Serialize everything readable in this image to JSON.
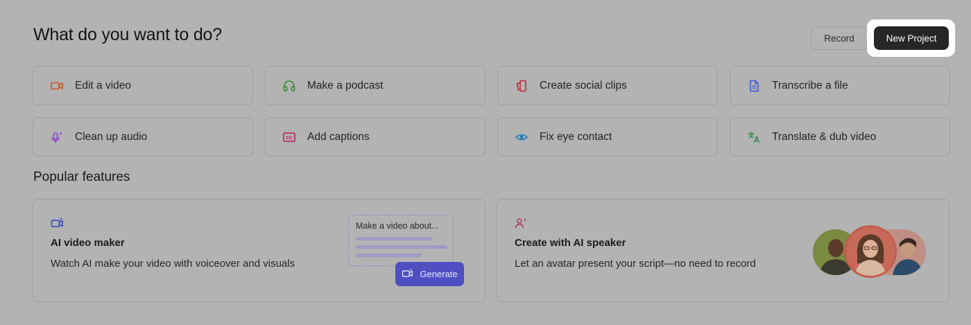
{
  "header": {
    "title": "What do you want to do?",
    "record_label": "Record",
    "new_project_label": "New Project"
  },
  "actions": [
    {
      "label": "Edit a video",
      "icon": "video-camera-icon",
      "color": "#c9521e"
    },
    {
      "label": "Make a podcast",
      "icon": "headphones-icon",
      "color": "#2f8a2f"
    },
    {
      "label": "Create social clips",
      "icon": "social-clips-icon",
      "color": "#c0262f"
    },
    {
      "label": "Transcribe a file",
      "icon": "document-icon",
      "color": "#3b5bd8"
    },
    {
      "label": "Clean up audio",
      "icon": "microphone-sparkle-icon",
      "color": "#8a3fd0"
    },
    {
      "label": "Add captions",
      "icon": "captions-icon",
      "color": "#c2185b"
    },
    {
      "label": "Fix eye contact",
      "icon": "eye-icon",
      "color": "#1f7fb8"
    },
    {
      "label": "Translate & dub video",
      "icon": "translate-icon",
      "color": "#2f8a4f"
    }
  ],
  "popular": {
    "title": "Popular features",
    "cards": [
      {
        "title": "AI video maker",
        "description": "Watch AI make your video with voiceover and visuals",
        "icon": "ai-video-icon",
        "prompt_text": "Make a video about...",
        "generate_label": "Generate"
      },
      {
        "title": "Create with AI speaker",
        "description": "Let an avatar present your script—no need to record",
        "icon": "ai-speaker-icon"
      }
    ]
  },
  "colors": {
    "overlay_background": "#b3b3b3",
    "primary_button": "#262626",
    "generate_button": "#4f4fc2"
  }
}
